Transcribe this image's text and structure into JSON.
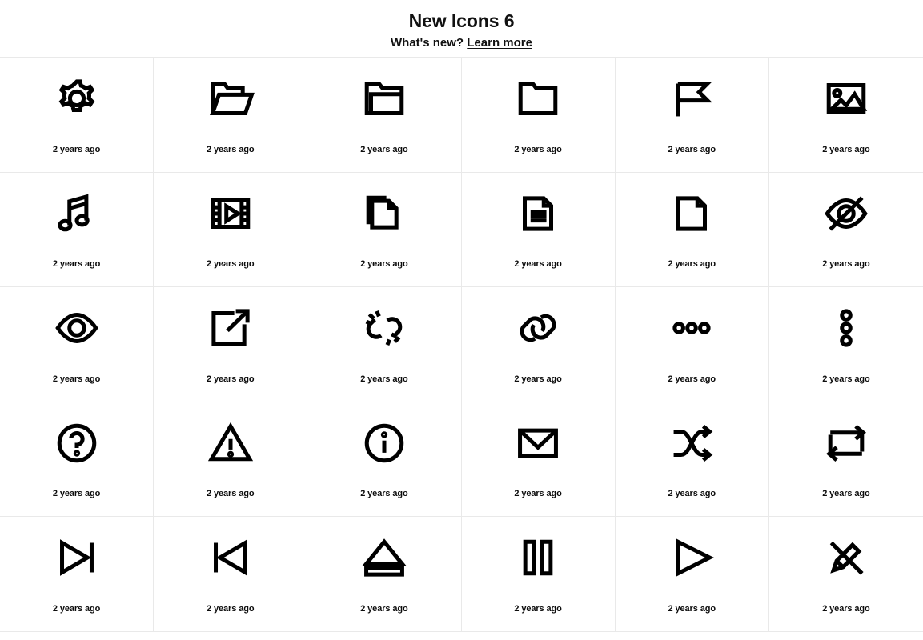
{
  "header": {
    "title": "New Icons 6",
    "subtitle_prefix": "What's new?",
    "link_label": "Learn more"
  },
  "grid": {
    "columns": 6,
    "caption_default": "2 years ago",
    "divider_color": "#e9e9e9",
    "icon_color": "#000000",
    "background": "#ffffff",
    "items": [
      {
        "icon": "gear-icon",
        "caption": "2 years ago"
      },
      {
        "icon": "folder-open-icon",
        "caption": "2 years ago"
      },
      {
        "icon": "folder-closed-icon",
        "caption": "2 years ago"
      },
      {
        "icon": "folder-icon",
        "caption": "2 years ago"
      },
      {
        "icon": "flag-icon",
        "caption": "2 years ago"
      },
      {
        "icon": "image-icon",
        "caption": "2 years ago"
      },
      {
        "icon": "music-note-icon",
        "caption": "2 years ago"
      },
      {
        "icon": "video-film-icon",
        "caption": "2 years ago"
      },
      {
        "icon": "copy-documents-icon",
        "caption": "2 years ago"
      },
      {
        "icon": "document-text-icon",
        "caption": "2 years ago"
      },
      {
        "icon": "file-blank-icon",
        "caption": "2 years ago"
      },
      {
        "icon": "eye-off-icon",
        "caption": "2 years ago"
      },
      {
        "icon": "eye-icon",
        "caption": "2 years ago"
      },
      {
        "icon": "external-link-icon",
        "caption": "2 years ago"
      },
      {
        "icon": "broken-link-icon",
        "caption": "2 years ago"
      },
      {
        "icon": "link-icon",
        "caption": "2 years ago"
      },
      {
        "icon": "more-horizontal-icon",
        "caption": "2 years ago"
      },
      {
        "icon": "more-vertical-icon",
        "caption": "2 years ago"
      },
      {
        "icon": "help-circle-icon",
        "caption": "2 years ago"
      },
      {
        "icon": "warning-triangle-icon",
        "caption": "2 years ago"
      },
      {
        "icon": "info-circle-icon",
        "caption": "2 years ago"
      },
      {
        "icon": "mail-envelope-icon",
        "caption": "2 years ago"
      },
      {
        "icon": "shuffle-icon",
        "caption": "2 years ago"
      },
      {
        "icon": "repeat-icon",
        "caption": "2 years ago"
      },
      {
        "icon": "skip-forward-icon",
        "caption": "2 years ago"
      },
      {
        "icon": "skip-backward-icon",
        "caption": "2 years ago"
      },
      {
        "icon": "eject-icon",
        "caption": "2 years ago"
      },
      {
        "icon": "pause-icon",
        "caption": "2 years ago"
      },
      {
        "icon": "play-icon",
        "caption": "2 years ago"
      },
      {
        "icon": "pencil-off-icon",
        "caption": "2 years ago"
      }
    ]
  }
}
